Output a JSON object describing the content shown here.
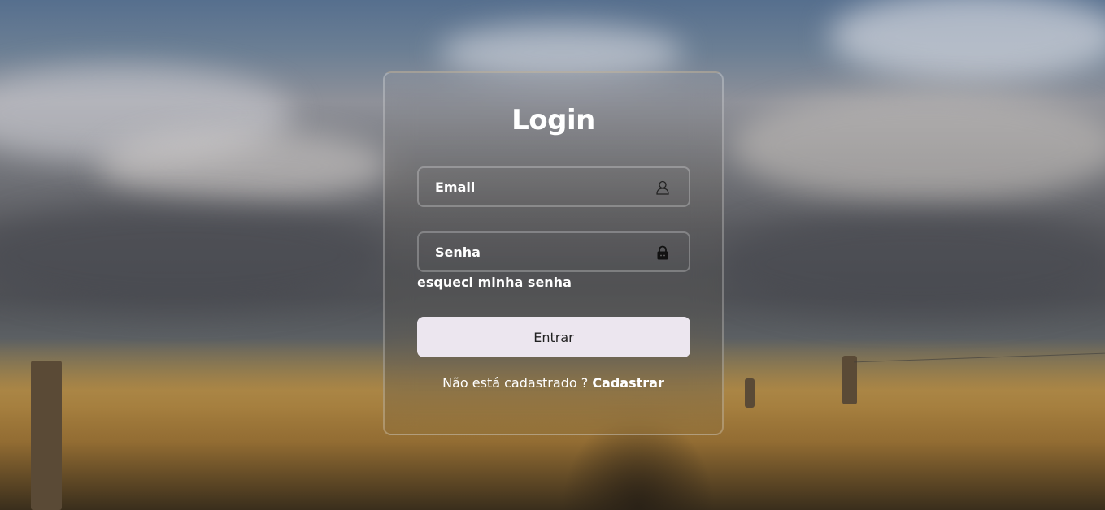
{
  "login": {
    "title": "Login",
    "email": {
      "placeholder": "Email",
      "icon": "user-icon"
    },
    "password": {
      "placeholder": "Senha",
      "icon": "lock-icon"
    },
    "forgot_label": "esqueci minha senha",
    "submit_label": "Entrar",
    "register_prompt": "Não está cadastrado ?",
    "register_link": "Cadastrar"
  },
  "colors": {
    "button_bg": "#ece6ef",
    "text": "#ffffff"
  }
}
